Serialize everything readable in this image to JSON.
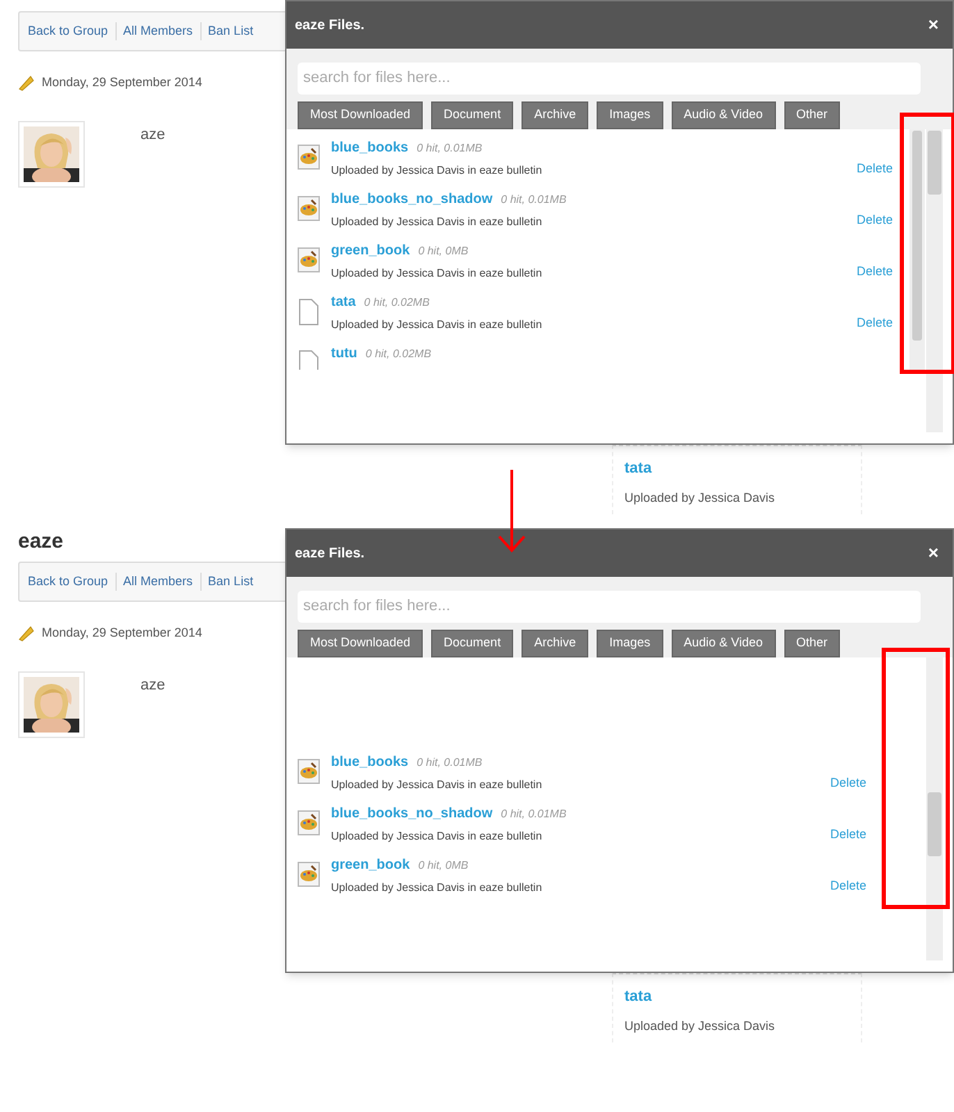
{
  "screens": [
    {
      "kind": "before",
      "nav": [
        {
          "label": "Back to Group"
        },
        {
          "label": "All Members"
        },
        {
          "label": "Ban List"
        }
      ],
      "date": "Monday, 29 September 2014",
      "member": {
        "name": "aze"
      },
      "modal": {
        "title": "eaze Files.",
        "close": "×",
        "search": {
          "placeholder": "search for files here..."
        },
        "filters": [
          "Most Downloaded",
          "Document",
          "Archive",
          "Images",
          "Audio & Video",
          "Other"
        ],
        "inner_scrollbar": true,
        "scrolled_to_end": false,
        "highlighted": true,
        "files": [
          {
            "name": "blue_books",
            "meta": "0 hit, 0.01MB",
            "uploader": "Uploaded by Jessica Davis in eaze bulletin",
            "action": "Delete"
          },
          {
            "name": "blue_books_no_shadow",
            "meta": "0 hit, 0.01MB",
            "uploader": "Uploaded by Jessica Davis in eaze bulletin",
            "action": "Delete"
          },
          {
            "name": "green_book",
            "meta": "0 hit, 0MB",
            "uploader": "Uploaded by Jessica Davis in eaze bulletin",
            "action": "Delete"
          },
          {
            "kind": "document",
            "name": "tata",
            "meta": "0 hit, 0.02MB",
            "uploader": "Uploaded by Jessica Davis in eaze bulletin",
            "action": "Delete"
          },
          {
            "kind": "document",
            "name": "tutu",
            "meta": "0 hit, 0.02MB"
          }
        ]
      },
      "card": {
        "title": "tata",
        "subtitle": "Uploaded by Jessica Davis"
      }
    },
    {
      "kind": "after",
      "heading": "eaze",
      "nav": [
        {
          "label": "Back to Group"
        },
        {
          "label": "All Members"
        },
        {
          "label": "Ban List"
        }
      ],
      "date": "Monday, 29 September 2014",
      "member": {
        "name": "aze"
      },
      "modal": {
        "title": "eaze Files.",
        "close": "×",
        "search": {
          "placeholder": "search for files here..."
        },
        "filters": [
          "Most Downloaded",
          "Document",
          "Archive",
          "Images",
          "Audio & Video",
          "Other"
        ],
        "inner_scrollbar": false,
        "scrolled_to_end": true,
        "highlighted": true,
        "files": [
          {
            "name": "blue_books",
            "meta": "0 hit, 0.01MB",
            "uploader": "Uploaded by Jessica Davis in eaze bulletin",
            "action": "Delete"
          },
          {
            "name": "blue_books_no_shadow",
            "meta": "0 hit, 0.01MB",
            "uploader": "Uploaded by Jessica Davis in eaze bulletin",
            "action": "Delete"
          },
          {
            "name": "green_book",
            "meta": "0 hit, 0MB",
            "uploader": "Uploaded by Jessica Davis in eaze bulletin",
            "action": "Delete"
          }
        ]
      },
      "card": {
        "title": "tata",
        "subtitle": "Uploaded by Jessica Davis"
      }
    }
  ]
}
